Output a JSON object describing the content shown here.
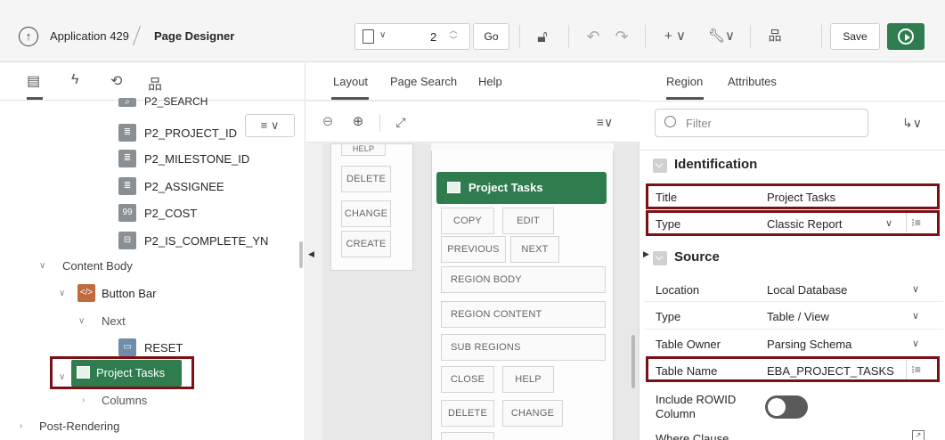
{
  "header": {
    "app_label": "Application 429",
    "page_title": "Page Designer",
    "page_number": "2",
    "go_label": "Go",
    "save_label": "Save"
  },
  "left_panel": {
    "tree": [
      {
        "label": "P2_SEARCH",
        "icon": "search-item-icon"
      },
      {
        "label": "P2_PROJECT_ID",
        "icon": "select-list-icon"
      },
      {
        "label": "P2_MILESTONE_ID",
        "icon": "select-list-icon"
      },
      {
        "label": "P2_ASSIGNEE",
        "icon": "select-list-icon"
      },
      {
        "label": "P2_COST",
        "icon": "number-field-icon"
      },
      {
        "label": "P2_IS_COMPLETE_YN",
        "icon": "switch-icon"
      },
      {
        "label": "Content Body",
        "icon": "chevron-down-icon"
      },
      {
        "label": "Button Bar",
        "icon": "static-content-icon"
      },
      {
        "label": "Next",
        "icon": "chevron-down-icon"
      },
      {
        "label": "RESET",
        "icon": "button-icon"
      },
      {
        "label": "Project Tasks",
        "icon": "classic-report-icon"
      },
      {
        "label": "Columns",
        "icon": "chevron-right-icon"
      },
      {
        "label": "Post-Rendering",
        "icon": "chevron-right-icon"
      }
    ]
  },
  "middle_panel": {
    "tabs": [
      "Layout",
      "Page Search",
      "Help"
    ],
    "left_positions": [
      "HELP",
      "DELETE",
      "CHANGE",
      "CREATE"
    ],
    "region_title": "Project Tasks",
    "region_positions": [
      "COPY",
      "EDIT",
      "PREVIOUS",
      "NEXT",
      "REGION BODY",
      "REGION CONTENT",
      "SUB REGIONS",
      "CLOSE",
      "HELP",
      "DELETE",
      "CHANGE"
    ]
  },
  "right_panel": {
    "tabs": [
      "Region",
      "Attributes"
    ],
    "filter_placeholder": "Filter",
    "groups": {
      "identification": "Identification",
      "source": "Source"
    },
    "properties": {
      "title": {
        "label": "Title",
        "value": "Project Tasks"
      },
      "type": {
        "label": "Type",
        "value": "Classic Report"
      },
      "location": {
        "label": "Location",
        "value": "Local Database"
      },
      "source_type": {
        "label": "Type",
        "value": "Table / View"
      },
      "table_owner": {
        "label": "Table Owner",
        "value": "Parsing Schema"
      },
      "table_name": {
        "label": "Table Name",
        "value": "EBA_PROJECT_TASKS"
      },
      "include_rowid": {
        "label": "Include ROWID Column"
      },
      "where_clause": {
        "label": "Where Clause"
      }
    }
  },
  "colors": {
    "accent_green": "#2f7d4f",
    "highlight_red": "#7a1117"
  }
}
